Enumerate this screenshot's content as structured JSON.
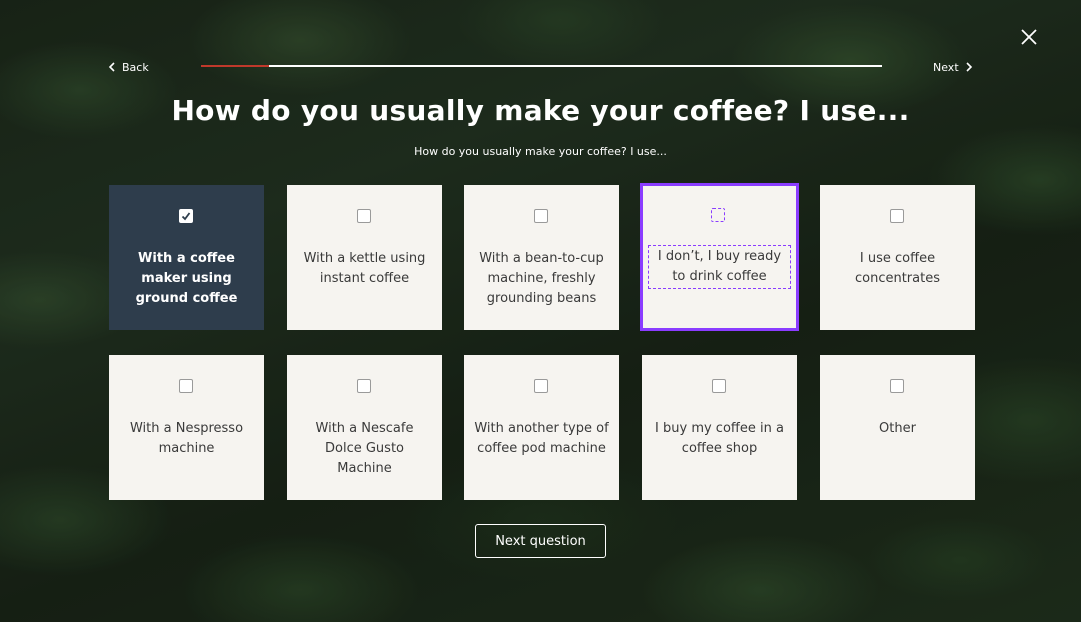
{
  "nav": {
    "back_label": "Back",
    "next_label": "Next",
    "progress_fraction": 0.1
  },
  "question": {
    "title": "How do you usually make your coffee? I use...",
    "subtitle": "How do you usually make your coffee? I use..."
  },
  "options": [
    {
      "label": "With a coffee maker using ground coffee",
      "selected": true,
      "focused": false
    },
    {
      "label": "With a kettle using instant coffee",
      "selected": false,
      "focused": false
    },
    {
      "label": "With a bean-to-cup machine, freshly grounding beans",
      "selected": false,
      "focused": false
    },
    {
      "label": "I don’t, I buy ready to drink coffee",
      "selected": false,
      "focused": true
    },
    {
      "label": "I use coffee concentrates",
      "selected": false,
      "focused": false
    },
    {
      "label": "With a Nespresso machine",
      "selected": false,
      "focused": false
    },
    {
      "label": "With a Nescafe Dolce Gusto Machine",
      "selected": false,
      "focused": false
    },
    {
      "label": "With another type of coffee pod machine",
      "selected": false,
      "focused": false
    },
    {
      "label": "I buy my coffee in a coffee shop",
      "selected": false,
      "focused": false
    },
    {
      "label": "Other",
      "selected": false,
      "focused": false
    }
  ],
  "footer": {
    "next_question_label": "Next question"
  },
  "colors": {
    "progress": "#c0392b",
    "selected_card": "#2e3d4c",
    "focus_ring": "#8a3cff"
  }
}
